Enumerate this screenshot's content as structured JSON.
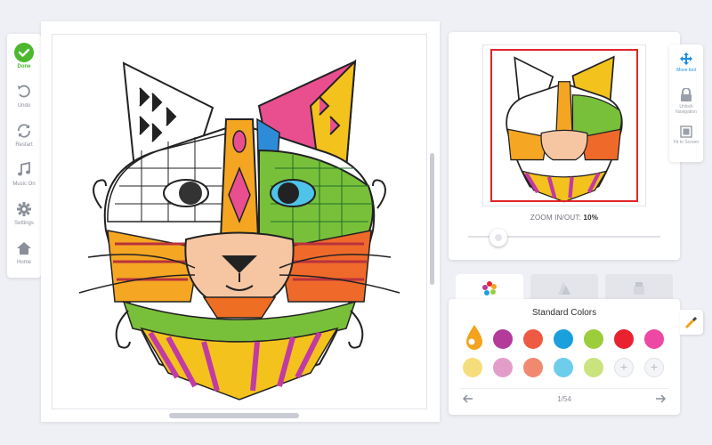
{
  "sidebar": {
    "items": [
      {
        "label": "Done",
        "icon": "check-icon"
      },
      {
        "label": "Undo",
        "icon": "undo-icon"
      },
      {
        "label": "Restart",
        "icon": "restart-icon"
      },
      {
        "label": "Music On",
        "icon": "music-icon"
      },
      {
        "label": "Settings",
        "icon": "gear-icon"
      },
      {
        "label": "Home",
        "icon": "home-icon"
      }
    ]
  },
  "nav": {
    "items": [
      {
        "label": "Move tool",
        "icon": "move-icon"
      },
      {
        "label": "Unlock Navigation",
        "icon": "lock-icon"
      },
      {
        "label": "Fit to Screen",
        "icon": "fit-screen-icon"
      }
    ]
  },
  "preview": {
    "zoom_prefix": "ZOOM IN/OUT:",
    "zoom_value": "10%"
  },
  "palette": {
    "title": "Standard Colors",
    "page": "1/54",
    "row1": [
      "#b43b9a",
      "#ee5a44",
      "#1aa0dc",
      "#9ccd3b",
      "#ea2230",
      "#ec48a4"
    ],
    "row2": [
      "#f6dd7c",
      "#e29ec9",
      "#f08970",
      "#6ecdeb",
      "#cae37e"
    ],
    "selected": "#f3a31c",
    "accent": "#1a8de6",
    "done_color": "#4cb82d"
  }
}
